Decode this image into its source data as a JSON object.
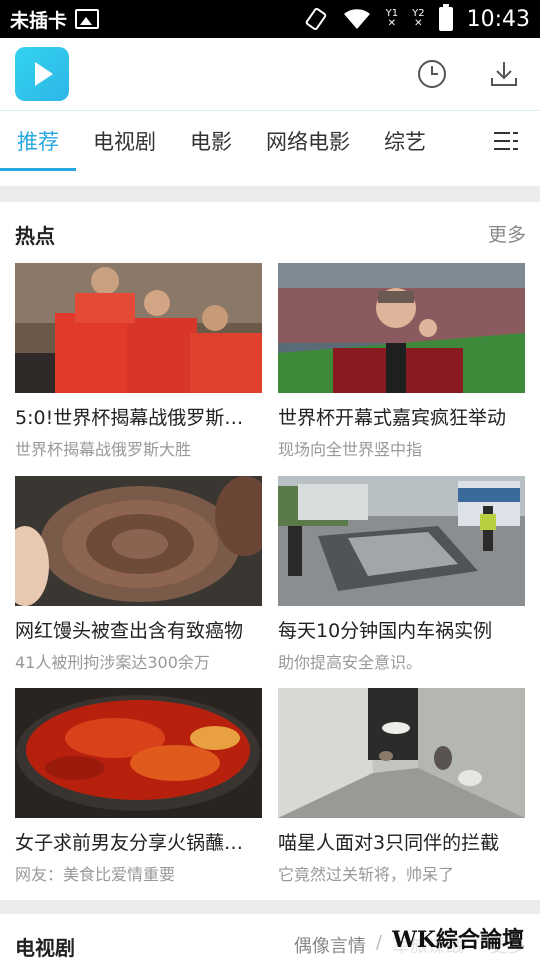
{
  "status_bar": {
    "carrier": "未插卡",
    "sim1": "Y1",
    "sim2": "Y2",
    "time": "10:43"
  },
  "app": {
    "logo_icon": "play-logo-icon",
    "history_icon": "clock-icon",
    "download_icon": "download-icon",
    "accent_color": "#28a8e0"
  },
  "tabs": [
    {
      "label": "推荐",
      "active": true
    },
    {
      "label": "电视剧"
    },
    {
      "label": "电影"
    },
    {
      "label": "网络电影"
    },
    {
      "label": "综艺"
    }
  ],
  "hot": {
    "title": "热点",
    "more": "更多",
    "cards": [
      {
        "title": "5:0!世界杯揭幕战俄罗斯…",
        "sub": "世界杯揭幕战俄罗斯大胜"
      },
      {
        "title": "世界杯开幕式嘉宾疯狂举动",
        "sub": "现场向全世界竖中指"
      },
      {
        "title": "网红馒头被查出含有致癌物",
        "sub": "41人被刑拘涉案达300余万"
      },
      {
        "title": "每天10分钟国内车祸实例",
        "sub": "助你提高安全意识。"
      },
      {
        "title": "女子求前男友分享火锅蘸…",
        "sub": "网友：美食比爱情重要"
      },
      {
        "title": "喵星人面对3只同伴的拦截",
        "sub": "它竟然过关斩将，帅呆了"
      }
    ]
  },
  "tv": {
    "title": "电视剧",
    "tags": [
      "偶像言情",
      "军旅谍战",
      "更多"
    ]
  },
  "watermark": "WK綜合論壇"
}
